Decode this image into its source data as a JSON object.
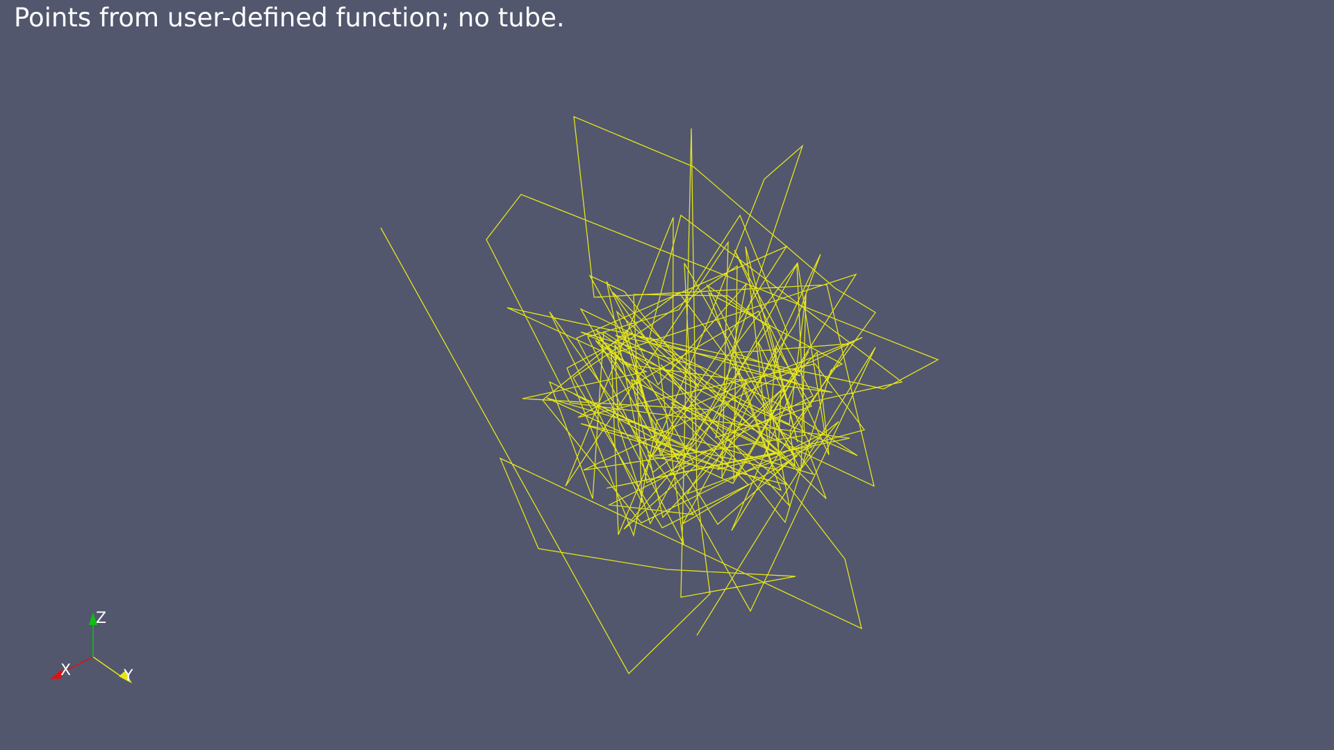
{
  "title": "Points from user-defined function; no tube.",
  "colors": {
    "background": "#52576e",
    "polyline": "#e6e619",
    "axis_x": "#e01010",
    "axis_y": "#e6e619",
    "axis_z": "#10c010",
    "text": "#ffffff"
  },
  "orientation_axes": {
    "x_label": "X",
    "y_label": "Y",
    "z_label": "Z"
  }
}
